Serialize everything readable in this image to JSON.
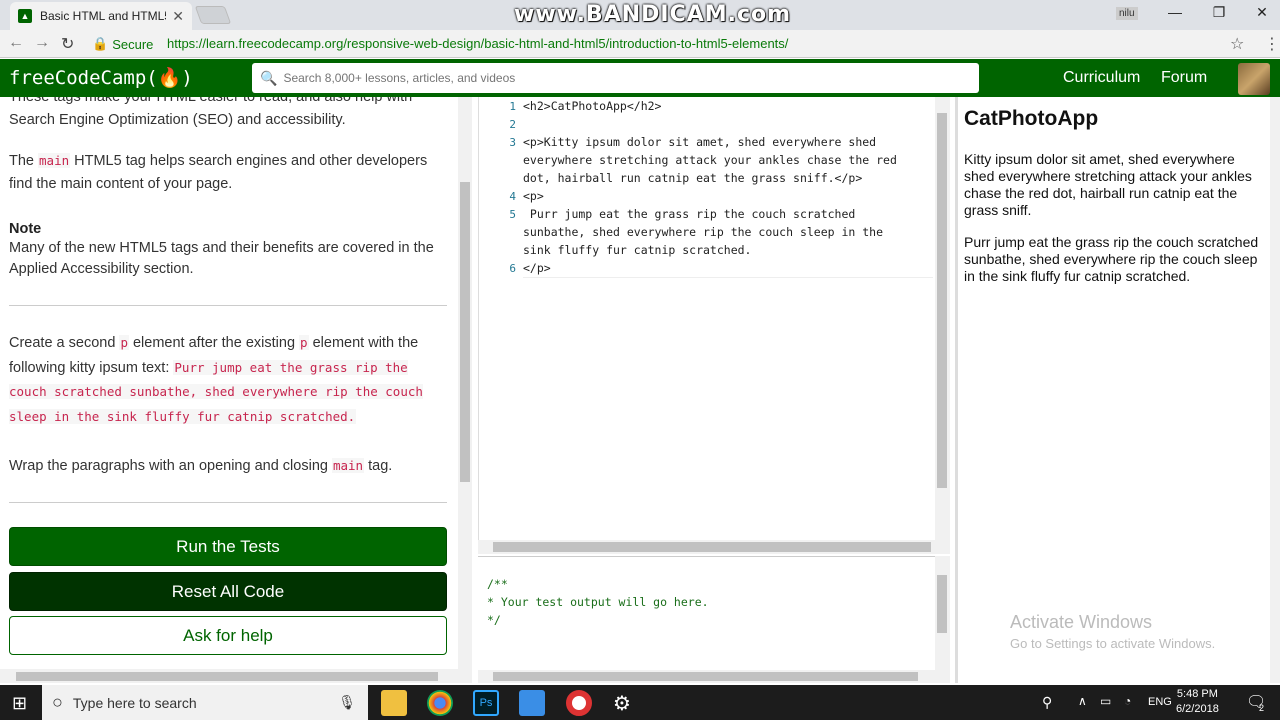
{
  "browser": {
    "tab_title": "Basic HTML and HTML5 ·",
    "tab_close": "✕",
    "watermark": "www.BANDICAM.com",
    "user_badge": "nilu",
    "minimize": "—",
    "restore": "❐",
    "close": "✕",
    "back": "←",
    "forward": "→",
    "reload": "↻",
    "secure_label": "Secure",
    "url": "https://learn.freecodecamp.org/responsive-web-design/basic-html-and-html5/introduction-to-html5-elements/",
    "star": "☆",
    "menu": "⋮"
  },
  "header": {
    "logo": "freeCodeCamp(🔥)",
    "search_placeholder": "Search 8,000+ lessons, articles, and videos",
    "nav_curriculum": "Curriculum",
    "nav_forum": "Forum"
  },
  "lesson": {
    "para_top": "These tags make your HTML easier to read, and also help with Search Engine Optimization (SEO) and accessibility.",
    "para_main_pre": "The ",
    "para_main_code": "main",
    "para_main_post": " HTML5 tag helps search engines and other developers find the main content of your page.",
    "note_title": "Note",
    "note_text": "Many of the new HTML5 tags and their benefits are covered in the Applied Accessibility section.",
    "task_pre": "Create a second ",
    "task_code1": "p",
    "task_mid": " element after the existing ",
    "task_code2": "p",
    "task_post": " element with the following kitty ipsum text: ",
    "task_code3": "Purr jump eat the grass rip the couch scratched sunbathe, shed everywhere rip the couch sleep in the sink fluffy fur catnip scratched.",
    "wrap_pre": "Wrap the paragraphs with an opening and closing ",
    "wrap_code": "main",
    "wrap_post": " tag.",
    "run_tests": "Run the Tests",
    "reset_code": "Reset All Code",
    "ask_help": "Ask for help",
    "colors": {
      "run_bg": "#006400",
      "reset_bg": "#003300"
    }
  },
  "editor": {
    "lines": [
      {
        "n": "1",
        "text": "<h2>CatPhotoApp</h2>"
      },
      {
        "n": "2",
        "text": ""
      },
      {
        "n": "3",
        "text": "<p>Kitty ipsum dolor sit amet, shed everywhere shed\neverywhere stretching attack your ankles chase the red\ndot, hairball run catnip eat the grass sniff.</p>"
      },
      {
        "n": "4",
        "text": "<p>"
      },
      {
        "n": "5",
        "text": " Purr jump eat the grass rip the couch scratched\nsunbathe, shed everywhere rip the couch sleep in the\nsink fluffy fur catnip scratched."
      },
      {
        "n": "6",
        "text": "</p>"
      }
    ]
  },
  "output": {
    "line1": "/**",
    "line2": "* Your test output will go here.",
    "line3": "*/"
  },
  "preview": {
    "h2": "CatPhotoApp",
    "p1": "Kitty ipsum dolor sit amet, shed everywhere shed everywhere stretching attack your ankles chase the red dot, hairball run catnip eat the grass sniff.",
    "p2": "Purr jump eat the grass rip the couch scratched sunbathe, shed everywhere rip the couch sleep in the sink fluffy fur catnip scratched."
  },
  "activation": {
    "title": "Activate Windows",
    "subtitle": "Go to Settings to activate Windows."
  },
  "taskbar": {
    "search_placeholder": "Type here to search",
    "lang": "ENG",
    "time": "5:48 PM",
    "date": "6/2/2018",
    "notif_count": "2"
  }
}
